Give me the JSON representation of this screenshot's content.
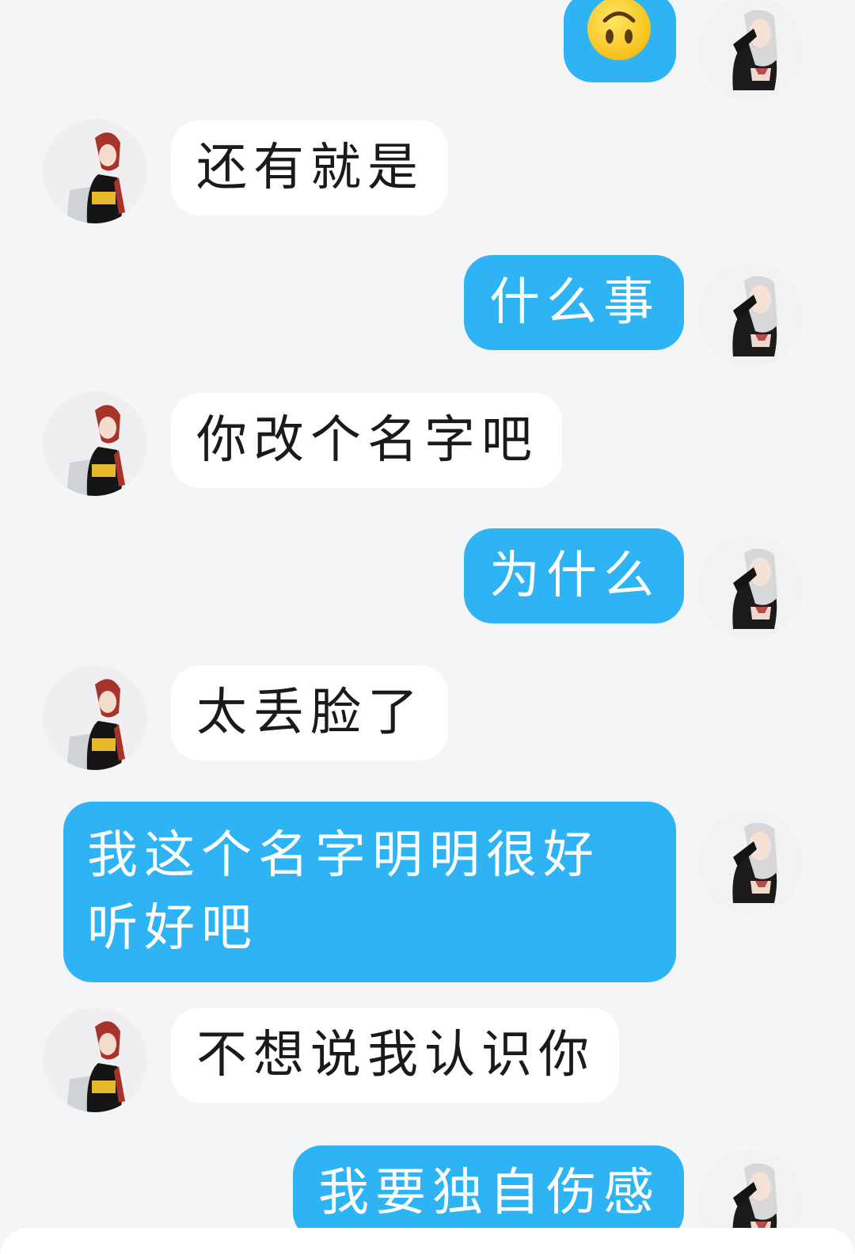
{
  "contact": {
    "avatar_icon": "anime-girl-red-hair-avatar-icon"
  },
  "self": {
    "avatar_icon": "anime-girl-silver-hair-avatar-icon"
  },
  "colors": {
    "background": "#f4f5f7",
    "incoming_bubble": "#ffffff",
    "outgoing_bubble": "#2eb3f5",
    "outgoing_text": "#ffffff",
    "incoming_text": "#1a1a1a"
  },
  "messages": [
    {
      "from": "self",
      "type": "emoji",
      "icon": "upside-down-face-emoji-icon"
    },
    {
      "from": "contact",
      "text": "还有就是"
    },
    {
      "from": "self",
      "text": "什么事"
    },
    {
      "from": "contact",
      "text": "你改个名字吧"
    },
    {
      "from": "self",
      "text": "为什么"
    },
    {
      "from": "contact",
      "text": "太丢脸了"
    },
    {
      "from": "self",
      "text": "我这个名字明明很好听好吧"
    },
    {
      "from": "contact",
      "text": "不想说我认识你"
    },
    {
      "from": "self",
      "text": "我要独自伤感"
    }
  ]
}
